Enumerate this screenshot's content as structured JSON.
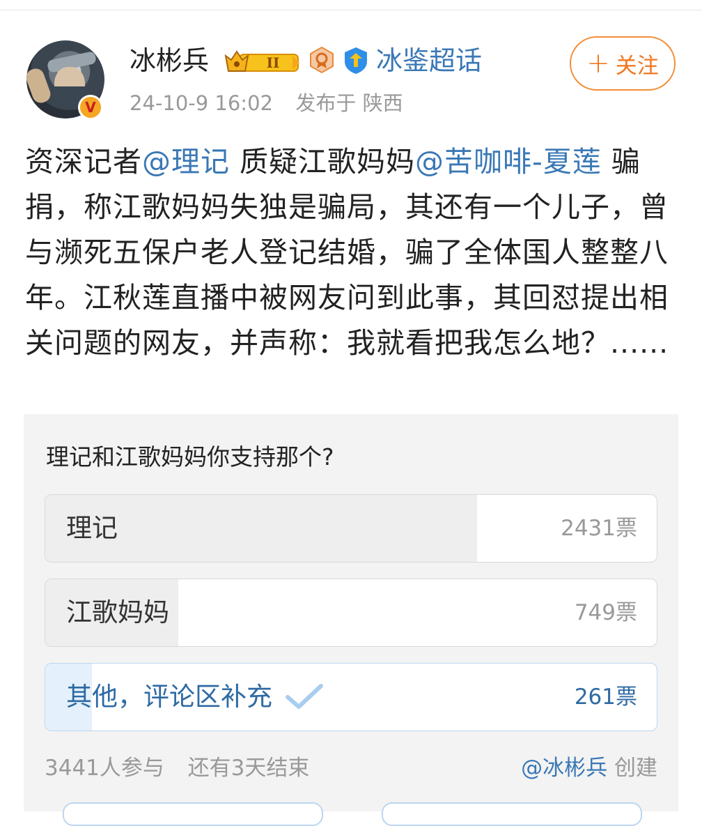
{
  "header": {
    "username": "冰彬兵",
    "topic": "冰鉴超话",
    "timestamp": "24-10-9 16:02",
    "location": "发布于 陕西",
    "follow_label": "关注",
    "follow_plus": "+"
  },
  "post": {
    "segments": [
      {
        "text": "资深记者",
        "type": "plain"
      },
      {
        "text": "@理记",
        "type": "mention"
      },
      {
        "text": " 质疑江歌妈妈",
        "type": "plain"
      },
      {
        "text": "@苦咖啡-夏莲",
        "type": "mention"
      },
      {
        "text": " 骗捐，称江歌妈妈失独是骗局，其还有一个儿子，曾与濒死五保户老人登记结婚，骗了全体国人整整八年。江秋莲直播中被网友问到此事，其回怼提出相关问题的网友，并声称：我就看把我怎么地？......",
        "type": "plain"
      }
    ]
  },
  "poll": {
    "title": "理记和江歌妈妈你支持那个?",
    "options": [
      {
        "label": "理记",
        "count": "2431票",
        "share": 0.706,
        "voted": false
      },
      {
        "label": "江歌妈妈",
        "count": "749票",
        "share": 0.218,
        "voted": false
      },
      {
        "label": "其他，评论区补充",
        "count": "261票",
        "share": 0.076,
        "voted": true
      }
    ],
    "participants": "3441人参与",
    "remaining": "还有3天结束",
    "creator_mention": "@冰彬兵",
    "creator_suffix": " 创建"
  },
  "colors": {
    "link": "#3a78b5",
    "follow": "#f2761e",
    "muted": "#999999"
  },
  "icons": [
    "crown-level-badge-icon",
    "medal-icon",
    "verified-shield-icon",
    "vip-v-badge-icon",
    "checkmark-icon"
  ]
}
